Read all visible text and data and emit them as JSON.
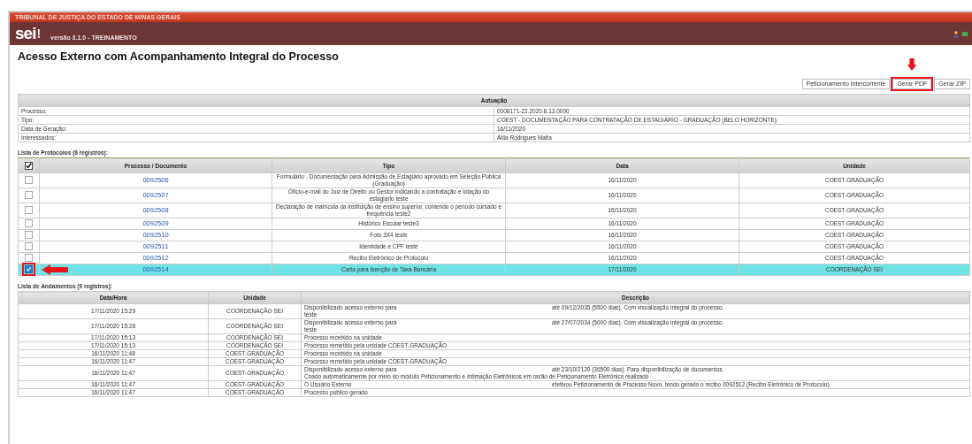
{
  "header": {
    "organization": "TRIBUNAL DE JUSTIÇA DO ESTADO DE MINAS GERAIS",
    "logo": "sei",
    "logo_mark": "!",
    "version": "versão 3.1.0 - TREINAMENTO"
  },
  "title": "Acesso Externo com Acompanhamento Integral do Processo",
  "buttons": [
    {
      "label": "Peticionamento Intercorrente",
      "marked": false
    },
    {
      "label": "Gerar PDF",
      "marked": true
    },
    {
      "label": "Gerar ZIP",
      "marked": false
    }
  ],
  "autuacao": {
    "heading": "Autuação",
    "rows": [
      {
        "label": "Processo:",
        "value": "0008171-22.2020.8.13.0000"
      },
      {
        "label": "Tipo:",
        "value": "COEST - DOCUMENTAÇÃO PARA CONTRATAÇÃO DE ESTAGIÁRIO - GRADUAÇÃO (BELO HORIZONTE)"
      },
      {
        "label": "Data de Geração:",
        "value": "16/11/2020"
      },
      {
        "label": "Interessados:",
        "value": "Átila Rodrigues Malta"
      }
    ]
  },
  "protocolos": {
    "caption": "Lista de Protocolos (8 registros):",
    "columns": [
      "Processo / Documento",
      "Tipo",
      "Data",
      "Unidade"
    ],
    "rows": [
      {
        "document": "0092506",
        "type": "Formulário - Documentação para Admissão de Estagiário aprovado em Seleção Pública (Graduação)",
        "date": "16/11/2020",
        "unit": "COEST-GRADUAÇÃO",
        "checked": false,
        "marked": false
      },
      {
        "document": "0092507",
        "type": "Ofício-e-mail do Juiz de Direito ou Gestor indicando a contratação e lotação do estagiário teste",
        "date": "16/11/2020",
        "unit": "COEST-GRADUAÇÃO",
        "checked": false,
        "marked": false
      },
      {
        "document": "0092508",
        "type": "Declaração de matrícula da instituição de ensino superior, contendo o período cursado e frequência teste2",
        "date": "16/11/2020",
        "unit": "COEST-GRADUAÇÃO",
        "checked": false,
        "marked": false
      },
      {
        "document": "0092509",
        "type": "Histórico Escolar teste3",
        "date": "16/11/2020",
        "unit": "COEST-GRADUAÇÃO",
        "checked": false,
        "marked": false
      },
      {
        "document": "0092510",
        "type": "Foto 3X4 teste",
        "date": "16/11/2020",
        "unit": "COEST-GRADUAÇÃO",
        "checked": false,
        "marked": false
      },
      {
        "document": "0092511",
        "type": "Identidade e CPF teste",
        "date": "16/11/2020",
        "unit": "COEST-GRADUAÇÃO",
        "checked": false,
        "marked": false
      },
      {
        "document": "0092512",
        "type": "Recibo Eletrônico de Protocolo",
        "date": "16/11/2020",
        "unit": "COEST-GRADUAÇÃO",
        "checked": false,
        "marked": false
      },
      {
        "document": "0092514",
        "type": "Carta para Isenção de Taxa Bancária",
        "date": "17/11/2020",
        "unit": "COORDENAÇÃO SEI",
        "checked": true,
        "marked": true
      }
    ]
  },
  "andamentos": {
    "caption": "Lista de Andamentos (9 registros):",
    "columns": [
      "Data/Hora",
      "Unidade",
      "Descrição"
    ],
    "rows": [
      {
        "datetime": "17/11/2020 15:29",
        "unit": "COORDENAÇÃO SEI",
        "lines": [
          [
            "Disponibilizado acesso externo para",
            "até 09/12/2035 (5500 dias). Com visualização integral do processo."
          ],
          [
            "teste"
          ]
        ]
      },
      {
        "datetime": "17/11/2020 15:28",
        "unit": "COORDENAÇÃO SEI",
        "lines": [
          [
            "Disponibilizado acesso externo para",
            "até 27/07/2034 (5000 dias). Com visualização integral do processo."
          ],
          [
            "teste"
          ]
        ]
      },
      {
        "datetime": "17/11/2020 15:13",
        "unit": "COORDENAÇÃO SEI",
        "lines": [
          [
            "Processo recebido na unidade"
          ]
        ]
      },
      {
        "datetime": "17/11/2020 15:13",
        "unit": "COORDENAÇÃO SEI",
        "lines": [
          [
            "Processo remetido pela unidade COEST-GRADUAÇÃO"
          ]
        ]
      },
      {
        "datetime": "16/11/2020 11:48",
        "unit": "COEST-GRADUAÇÃO",
        "lines": [
          [
            "Processo recebido na unidade"
          ]
        ]
      },
      {
        "datetime": "16/11/2020 11:47",
        "unit": "COEST-GRADUAÇÃO",
        "lines": [
          [
            "Processo remetido pela unidade COEST-GRADUAÇÃO"
          ]
        ]
      },
      {
        "datetime": "16/11/2020 11:47",
        "unit": "COEST-GRADUAÇÃO",
        "lines": [
          [
            "Disponibilizado acesso externo para",
            "até 23/10/2120 (36500 dias). Para disponibilização de documentos."
          ],
          [
            "Criado automaticamente por meio do módulo Peticionamento e Intimação Eletrônicos em razão de Peticionamento Eletrônico realizado"
          ]
        ]
      },
      {
        "datetime": "16/11/2020 11:47",
        "unit": "COEST-GRADUAÇÃO",
        "lines": [
          [
            "O Usuário Externo",
            "efetivou Peticionamento de Processo Novo, tendo gerado o recibo 0092512 (Recibo Eletrônico de Protocolo)."
          ]
        ]
      },
      {
        "datetime": "16/11/2020 11:47",
        "unit": "COEST-GRADUAÇÃO",
        "lines": [
          [
            "Processo público gerado"
          ]
        ]
      }
    ]
  }
}
